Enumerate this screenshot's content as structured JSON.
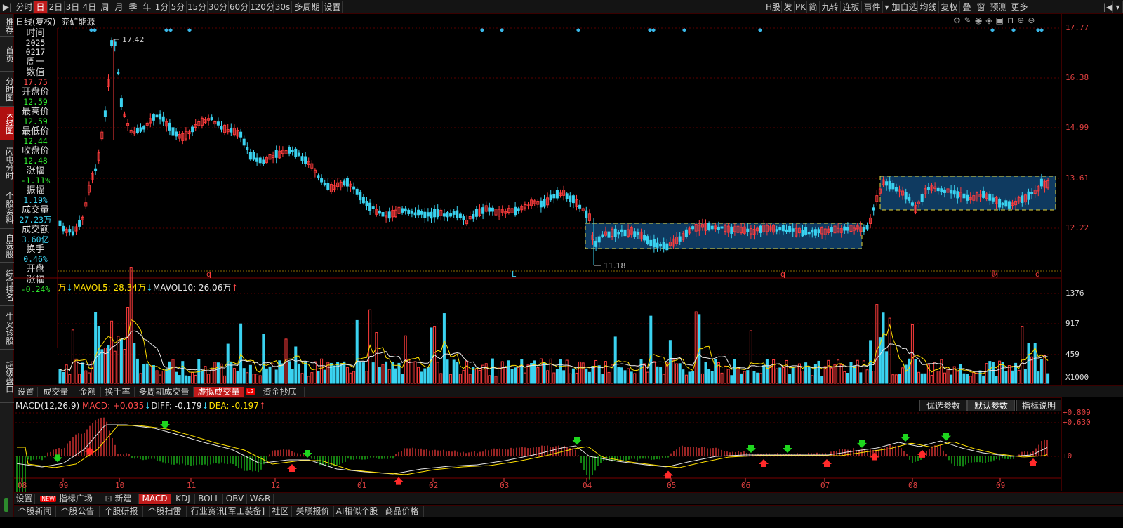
{
  "toolbar": {
    "periods": [
      "分时",
      "日",
      "2日",
      "3日",
      "4日",
      "周",
      "月",
      "季",
      "年",
      "1分",
      "5分",
      "15分",
      "30分",
      "60分",
      "120分",
      "30s",
      "多周期",
      "设置"
    ],
    "active_period": "日",
    "right_items": [
      "H股",
      "发",
      "PK",
      "简",
      "九转",
      "连板",
      "事件",
      "加自选",
      "均线",
      "复权",
      "叠",
      "窗",
      "预测",
      "更多"
    ],
    "expand_icon": "chevron-down-icon"
  },
  "left_nav": [
    "推荐",
    "首页",
    "分时图",
    "K线图",
    "闪电分时",
    "个股资料",
    "自选股",
    "综合排名",
    "牛叉诊股",
    "超级盘口"
  ],
  "left_nav_active": "K线图",
  "chart_title": {
    "period": "日线(复权)",
    "stock": "兖矿能源"
  },
  "info_panel": {
    "time_label": "时间",
    "year": "2025",
    "date": "0217",
    "weekday": "周一",
    "value_label": "数值",
    "value": "17.75",
    "open_label": "开盘价",
    "open": "12.59",
    "high_label": "最高价",
    "high": "12.59",
    "low_label": "最低价",
    "low": "12.44",
    "close_label": "收盘价",
    "close": "12.48",
    "change_label": "涨幅",
    "change": "-1.11%",
    "amplitude_label": "振幅",
    "amplitude": "1.19%",
    "volume_label": "成交量",
    "volume": "27.23万",
    "amount_label": "成交额",
    "amount": "3.60亿",
    "turnover_label": "换手",
    "turnover": "0.46%",
    "open_change_label": "开盘涨幅",
    "open_change": "-0.24%"
  },
  "price_axis": [
    "17.77",
    "16.38",
    "14.99",
    "13.61",
    "12.22"
  ],
  "price_annotations": {
    "high": "17.42",
    "low": "11.18"
  },
  "event_markers": [
    "q",
    "L",
    "q",
    "财",
    "q"
  ],
  "volume_legend": {
    "unit": "万",
    "mavol5": "MAVOL5: 28.34万",
    "mavol10": "MAVOL10: 26.06万"
  },
  "volume_axis": [
    "1376",
    "917",
    "459",
    "X1000"
  ],
  "volume_tabs": [
    "设置",
    "成交量",
    "金额",
    "换手率",
    "多周期成交量",
    "虚拟成交量",
    "资金抄底"
  ],
  "volume_tab_active": "虚拟成交量",
  "l2_badge": "L2",
  "macd_legend": {
    "name": "MACD(12,26,9)",
    "macd": "MACD: +0.035",
    "diff": "DIFF: -0.179",
    "dea": "DEA: -0.197"
  },
  "macd_buttons": [
    "优选参数",
    "默认参数",
    "指标说明"
  ],
  "macd_button_active": "默认参数",
  "macd_axis": [
    "+0.809",
    "+0.630",
    "+0"
  ],
  "months": [
    "08",
    "09",
    "10",
    "11",
    "12",
    "01",
    "02",
    "03",
    "04",
    "05",
    "06",
    "07",
    "08",
    "09"
  ],
  "indicator_tabs": [
    "设置",
    "指标广场",
    "新建",
    "MACD",
    "KDJ",
    "BOLL",
    "OBV",
    "W&R"
  ],
  "indicator_tab_active": "MACD",
  "new_badge": "NEW",
  "news_tabs": [
    "个股新闻",
    "个股公告",
    "个股研报",
    "个股扫雷",
    "行业资讯[军工装备]",
    "社区",
    "关联报价",
    "AI相似个股",
    "商品价格"
  ],
  "colors": {
    "up": "#ff3c3c",
    "down": "#3ad2f0",
    "ma_white": "#e6e6e6",
    "ma_yellow": "#ffe000",
    "box_fill": "#0f3a60",
    "box_border": "#e8d838"
  }
}
